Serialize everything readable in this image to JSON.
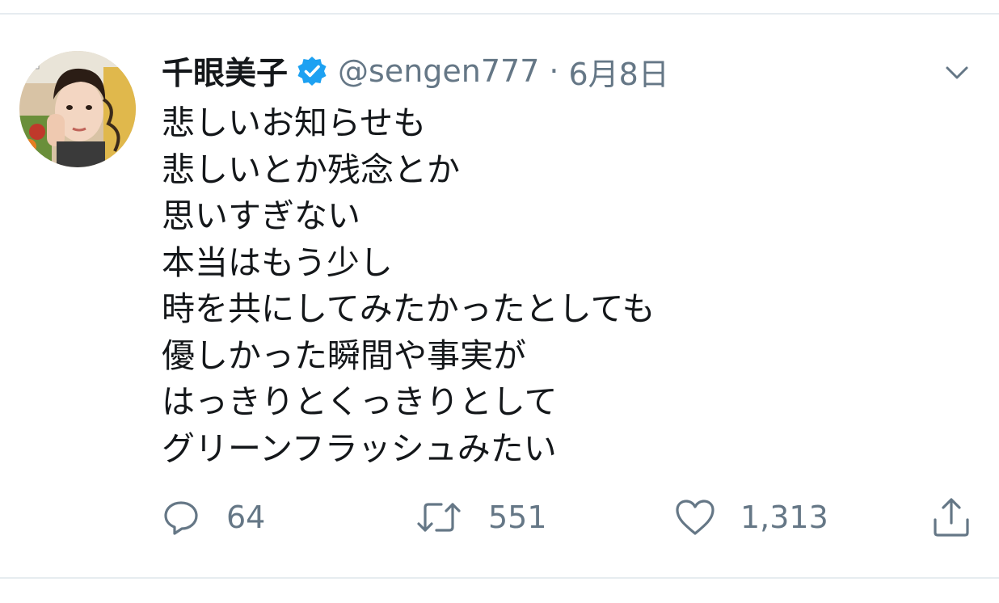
{
  "tweet": {
    "display_name": "千眼美子",
    "verified": true,
    "handle": "@sengen777",
    "separator": "·",
    "timestamp": "6月8日",
    "lines": [
      "悲しいお知らせも",
      "悲しいとか残念とか",
      "思いすぎない",
      "本当はもう少し",
      "時を共にしてみたかったとしても",
      "優しかった瞬間や事実が",
      "はっきりとくっきりとして",
      "グリーンフラッシュみたい"
    ]
  },
  "actions": {
    "reply_count": "64",
    "retweet_count": "551",
    "like_count": "1,313"
  },
  "icons": {
    "verified": "verified-badge-icon",
    "menu": "chevron-down-icon",
    "reply": "reply-icon",
    "retweet": "retweet-icon",
    "like": "heart-icon",
    "share": "share-icon"
  },
  "colors": {
    "text": "#14171a",
    "secondary": "#657786",
    "verified_blue": "#1da1f2",
    "divider": "#e6ecf0"
  }
}
